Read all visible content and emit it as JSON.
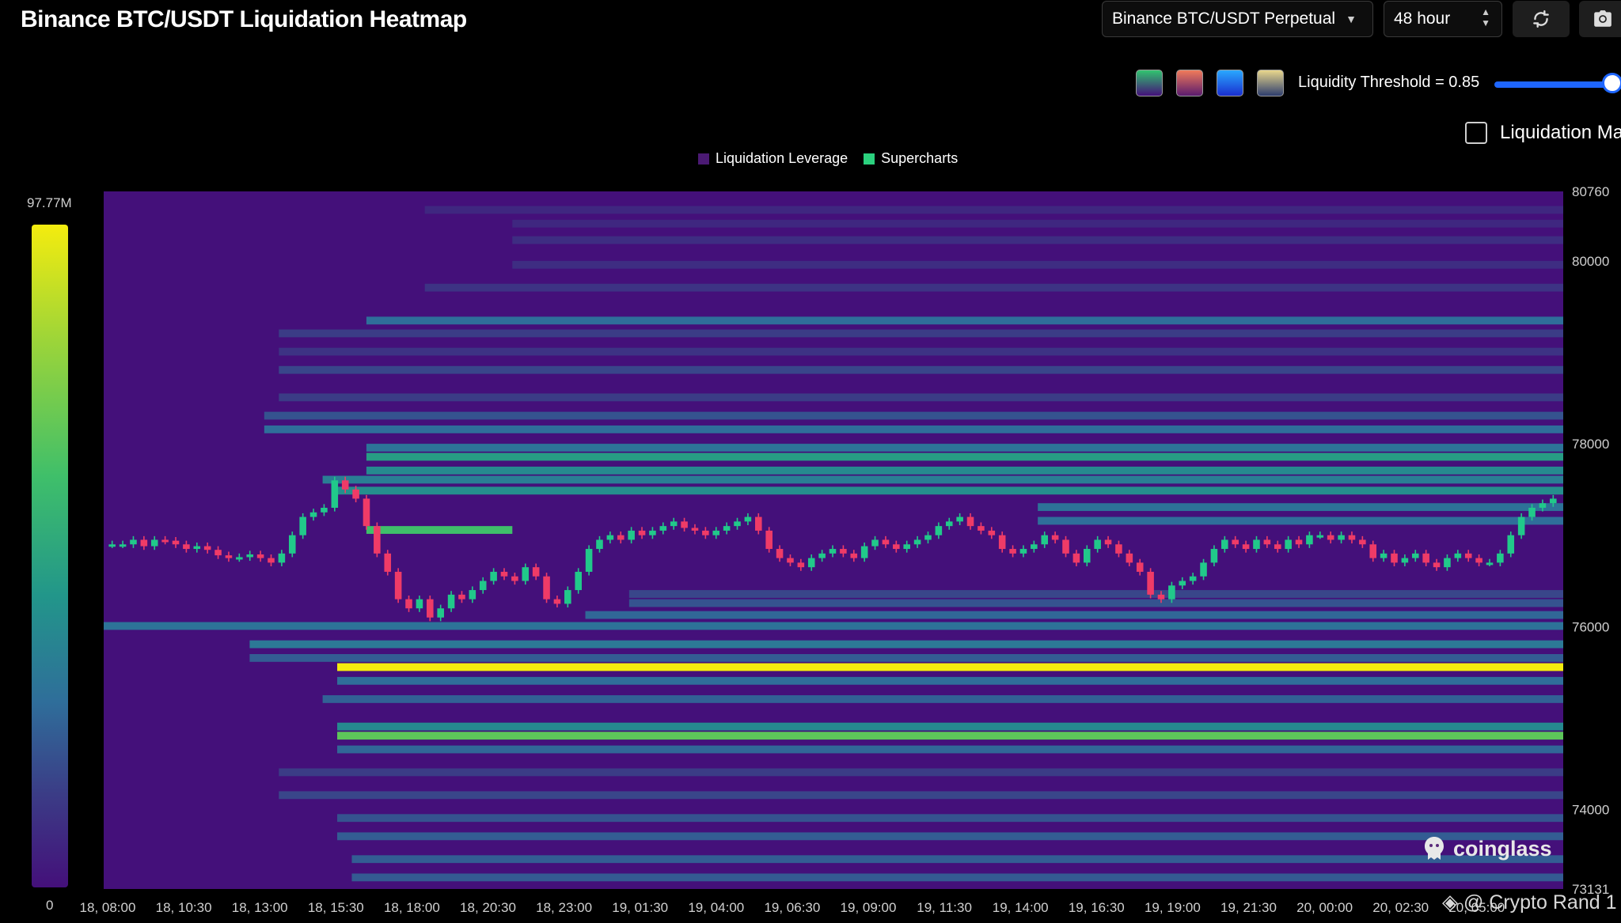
{
  "header": {
    "title": "Binance BTC/USDT Liquidation Heatmap",
    "pair_select": "Binance BTC/USDT Perpetual",
    "range_select": "48 hour"
  },
  "controls": {
    "threshold_label": "Liquidity Threshold = 0.85",
    "threshold_value": 0.85,
    "checkbox_label": "Liquidation Ma",
    "checkbox_checked": false,
    "swatches": [
      {
        "name": "viridis",
        "top": "#31c46f",
        "bottom": "#44107a"
      },
      {
        "name": "magma",
        "top": "#f07a5a",
        "bottom": "#5a1b6e"
      },
      {
        "name": "blue",
        "top": "#29a8ff",
        "bottom": "#1a2fd0"
      },
      {
        "name": "mono",
        "top": "#e9d78c",
        "bottom": "#2e3e6e"
      }
    ]
  },
  "legend": {
    "items": [
      {
        "label": "Liquidation Leverage",
        "color": "#4b1a73"
      },
      {
        "label": "Supercharts",
        "color": "#2bd17e"
      }
    ]
  },
  "scale": {
    "max_label": "97.77M",
    "min_label": "0"
  },
  "chart_data": {
    "type": "heatmap",
    "title": "Binance BTC/USDT Liquidation Heatmap",
    "background_color": "#44107a",
    "y_axis": {
      "min": 73131,
      "max": 80760,
      "position": "right",
      "ticks": [
        80760,
        80000,
        78000,
        76000,
        74000,
        73131
      ]
    },
    "x_axis": {
      "ticks": [
        "18, 08:00",
        "18, 10:30",
        "18, 13:00",
        "18, 15:30",
        "18, 18:00",
        "18, 20:30",
        "18, 23:00",
        "19, 01:30",
        "19, 04:00",
        "19, 06:30",
        "19, 09:00",
        "19, 11:30",
        "19, 14:00",
        "19, 16:30",
        "19, 19:00",
        "19, 21:30",
        "20, 00:00",
        "20, 02:30",
        "20, 05:00"
      ]
    },
    "liquidation_bands": [
      {
        "price": 80550,
        "start": 0.22,
        "intensity": 0.08
      },
      {
        "price": 80400,
        "start": 0.28,
        "intensity": 0.08
      },
      {
        "price": 80220,
        "start": 0.28,
        "intensity": 0.1
      },
      {
        "price": 79950,
        "start": 0.28,
        "intensity": 0.1
      },
      {
        "price": 79700,
        "start": 0.22,
        "intensity": 0.12
      },
      {
        "price": 79340,
        "start": 0.18,
        "intensity": 0.3
      },
      {
        "price": 79200,
        "start": 0.12,
        "intensity": 0.15
      },
      {
        "price": 79000,
        "start": 0.12,
        "intensity": 0.12
      },
      {
        "price": 78800,
        "start": 0.12,
        "intensity": 0.18
      },
      {
        "price": 78500,
        "start": 0.12,
        "intensity": 0.15
      },
      {
        "price": 78300,
        "start": 0.11,
        "intensity": 0.22
      },
      {
        "price": 78150,
        "start": 0.11,
        "intensity": 0.3
      },
      {
        "price": 77950,
        "start": 0.18,
        "intensity": 0.32
      },
      {
        "price": 77850,
        "start": 0.18,
        "intensity": 0.48
      },
      {
        "price": 77700,
        "start": 0.18,
        "intensity": 0.4
      },
      {
        "price": 77600,
        "start": 0.15,
        "intensity": 0.36
      },
      {
        "price": 77480,
        "start": 0.16,
        "intensity": 0.42
      },
      {
        "price": 77300,
        "start": 0.64,
        "intensity": 0.32
      },
      {
        "price": 77150,
        "start": 0.64,
        "intensity": 0.3
      },
      {
        "price": 77050,
        "start": 0.18,
        "intensity": 0.62,
        "end": 0.28
      },
      {
        "price": 76350,
        "start": 0.36,
        "intensity": 0.18
      },
      {
        "price": 76250,
        "start": 0.36,
        "intensity": 0.22
      },
      {
        "price": 76120,
        "start": 0.33,
        "intensity": 0.28
      },
      {
        "price": 76000,
        "start": 0.0,
        "intensity": 0.32
      },
      {
        "price": 75800,
        "start": 0.1,
        "intensity": 0.34
      },
      {
        "price": 75650,
        "start": 0.1,
        "intensity": 0.25
      },
      {
        "price": 75550,
        "start": 0.16,
        "intensity": 1.0
      },
      {
        "price": 75400,
        "start": 0.16,
        "intensity": 0.3
      },
      {
        "price": 75200,
        "start": 0.15,
        "intensity": 0.26
      },
      {
        "price": 74900,
        "start": 0.16,
        "intensity": 0.4
      },
      {
        "price": 74800,
        "start": 0.16,
        "intensity": 0.68
      },
      {
        "price": 74650,
        "start": 0.16,
        "intensity": 0.28
      },
      {
        "price": 74400,
        "start": 0.12,
        "intensity": 0.15
      },
      {
        "price": 74150,
        "start": 0.12,
        "intensity": 0.18
      },
      {
        "price": 73900,
        "start": 0.16,
        "intensity": 0.22
      },
      {
        "price": 73700,
        "start": 0.16,
        "intensity": 0.25
      },
      {
        "price": 73450,
        "start": 0.17,
        "intensity": 0.25
      },
      {
        "price": 73250,
        "start": 0.17,
        "intensity": 0.24
      }
    ],
    "price_series": [
      76900,
      76900,
      76950,
      76880,
      76950,
      76940,
      76900,
      76850,
      76880,
      76840,
      76780,
      76750,
      76760,
      76790,
      76750,
      76700,
      76800,
      77000,
      77200,
      77250,
      77300,
      77600,
      77500,
      77400,
      77100,
      76800,
      76600,
      76300,
      76200,
      76300,
      76100,
      76200,
      76350,
      76300,
      76400,
      76500,
      76600,
      76550,
      76500,
      76650,
      76550,
      76300,
      76250,
      76400,
      76600,
      76850,
      76950,
      77000,
      76950,
      77050,
      77000,
      77050,
      77100,
      77150,
      77080,
      77050,
      77000,
      77050,
      77100,
      77150,
      77200,
      77050,
      76850,
      76750,
      76700,
      76650,
      76750,
      76800,
      76850,
      76800,
      76750,
      76880,
      76950,
      76900,
      76850,
      76900,
      76950,
      77000,
      77100,
      77150,
      77200,
      77100,
      77050,
      77000,
      76850,
      76800,
      76850,
      76900,
      77000,
      76950,
      76800,
      76700,
      76850,
      76950,
      76900,
      76800,
      76700,
      76600,
      76350,
      76300,
      76450,
      76500,
      76550,
      76700,
      76850,
      76950,
      76900,
      76850,
      76950,
      76900,
      76850,
      76950,
      76900,
      77000,
      77000,
      76950,
      77000,
      76950,
      76900,
      76750,
      76800,
      76700,
      76750,
      76800,
      76700,
      76650,
      76750,
      76800,
      76750,
      76700,
      76700,
      76800,
      77000,
      77200,
      77300,
      77350,
      77400
    ]
  },
  "watermark": {
    "brand": "coinglass",
    "credit": "@ Crypto Rand 1"
  }
}
